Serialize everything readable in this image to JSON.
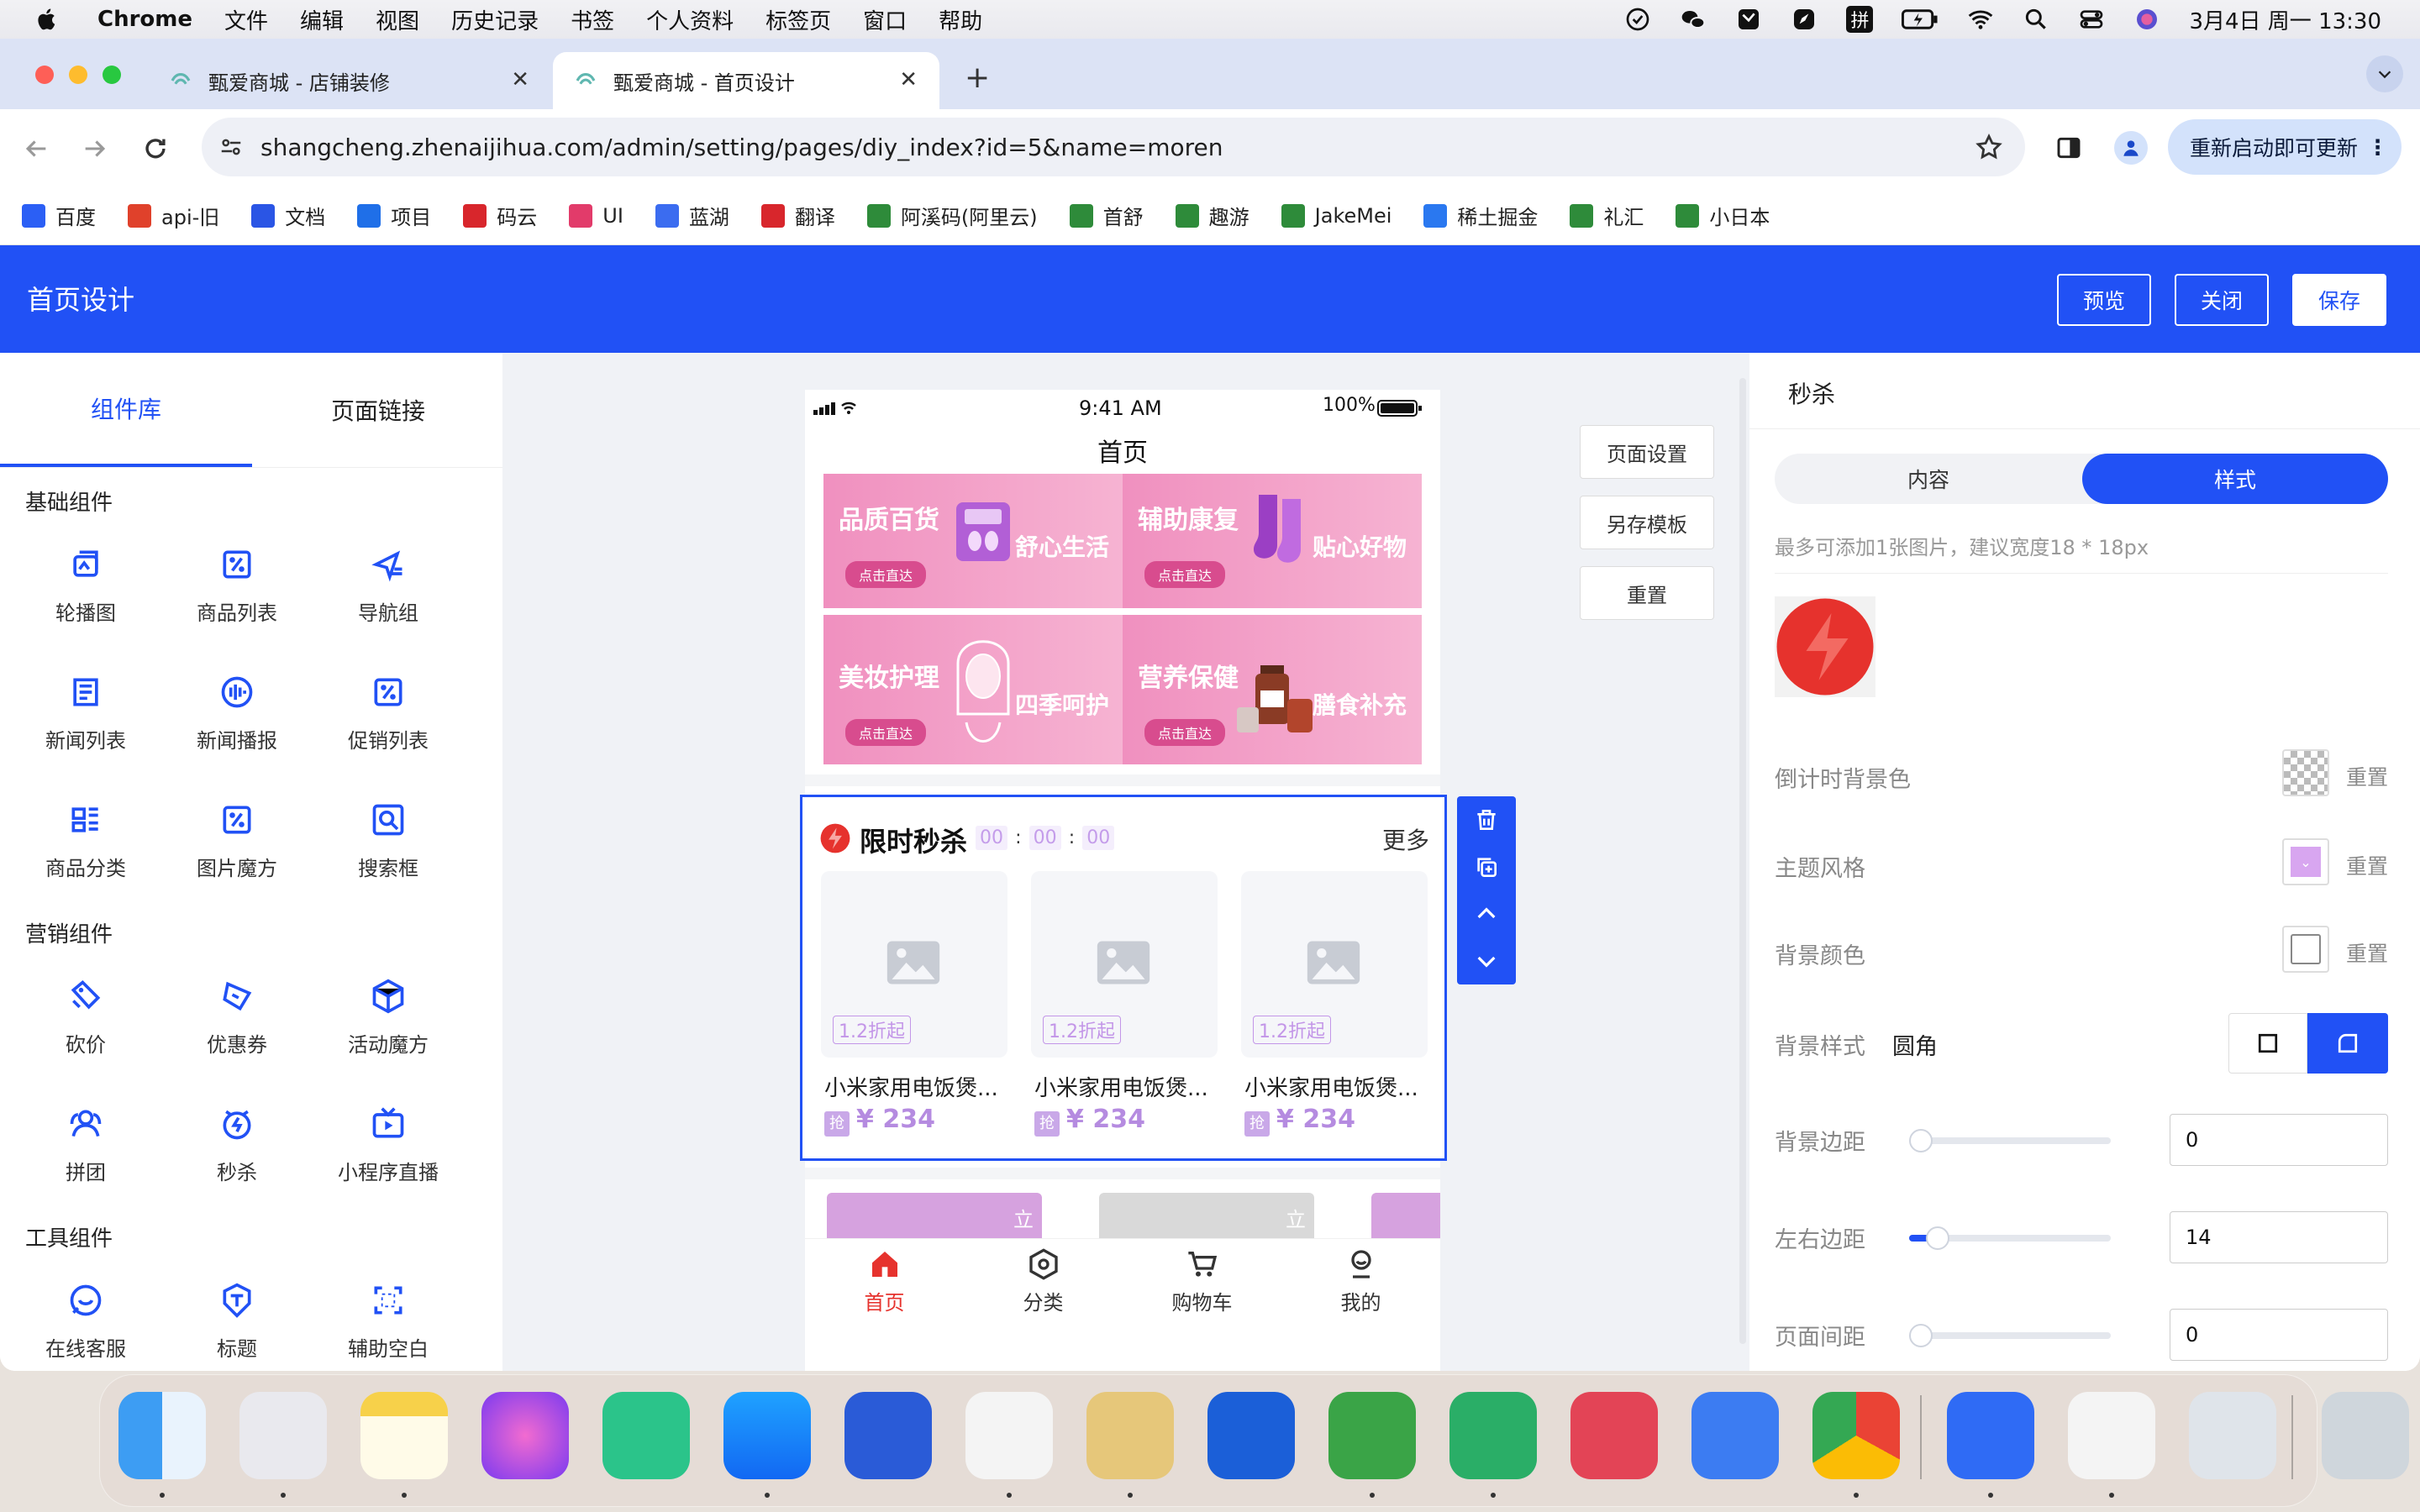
{
  "menubar": {
    "app": "Chrome",
    "menus": [
      "文件",
      "编辑",
      "视图",
      "历史记录",
      "书签",
      "个人资料",
      "标签页",
      "窗口",
      "帮助"
    ],
    "datetime": "3月4日 周一  13:30",
    "ime": "拼"
  },
  "tabs": [
    {
      "title": "甄爱商城 - 店铺装修"
    },
    {
      "title": "甄爱商城 - 首页设计"
    }
  ],
  "address": "shangcheng.zhenaijihua.com/admin/setting/pages/diy_index?id=5&name=moren",
  "update_button": "重新启动即可更新",
  "bookmarks": [
    {
      "label": "百度",
      "color": "#2b5ff5"
    },
    {
      "label": "api-旧",
      "color": "#e0412b"
    },
    {
      "label": "文档",
      "color": "#2a55e5"
    },
    {
      "label": "项目",
      "color": "#1f6fe8"
    },
    {
      "label": "码云",
      "color": "#d8262c"
    },
    {
      "label": "UI",
      "color": "#e23b6a"
    },
    {
      "label": "蓝湖",
      "color": "#3b6cf0"
    },
    {
      "label": "翻译",
      "color": "#d8262c"
    },
    {
      "label": "阿溪码(阿里云)",
      "color": "#2e8b3a"
    },
    {
      "label": "首舒",
      "color": "#2e8b3a"
    },
    {
      "label": "趣游",
      "color": "#2e8b3a"
    },
    {
      "label": "JakeMei",
      "color": "#2e8b3a"
    },
    {
      "label": "稀土掘金",
      "color": "#2a78f0"
    },
    {
      "label": "礼汇",
      "color": "#2e8b3a"
    },
    {
      "label": "小日本",
      "color": "#2e8b3a"
    }
  ],
  "header": {
    "title": "首页设计",
    "preview": "预览",
    "close": "关闭",
    "save": "保存",
    "accent": "#2151f5"
  },
  "left": {
    "tab_components": "组件库",
    "tab_links": "页面链接",
    "sections": [
      {
        "title": "基础组件",
        "items": [
          "轮播图",
          "商品列表",
          "导航组",
          "新闻列表",
          "新闻播报",
          "促销列表",
          "商品分类",
          "图片魔方",
          "搜索框"
        ]
      },
      {
        "title": "营销组件",
        "items": [
          "砍价",
          "优惠券",
          "活动魔方",
          "拼团",
          "秒杀",
          "小程序直播"
        ]
      },
      {
        "title": "工具组件",
        "items": [
          "在线客服",
          "标题",
          "辅助空白"
        ]
      }
    ]
  },
  "phone": {
    "status_time": "9:41 AM",
    "battery": "100%",
    "title": "首页",
    "banners": [
      {
        "title": "品质百货",
        "sub": "舒心生活",
        "btn": "点击直达"
      },
      {
        "title": "辅助康复",
        "sub": "贴心好物",
        "btn": "点击直达"
      },
      {
        "title": "美妆护理",
        "sub": "四季呵护",
        "btn": "点击直达"
      },
      {
        "title": "营养保健",
        "sub": "膳食补充",
        "btn": "点击直达"
      }
    ],
    "seckill": {
      "title": "限时秒杀",
      "timer": [
        "00",
        "00",
        "00"
      ],
      "more": "更多",
      "products": [
        {
          "tag": "1.2折起",
          "name": "小米家用电饭煲...",
          "badge": "抢",
          "price": "¥ 234"
        },
        {
          "tag": "1.2折起",
          "name": "小米家用电饭煲...",
          "badge": "抢",
          "price": "¥ 234"
        },
        {
          "tag": "1.2折起",
          "name": "小米家用电饭煲...",
          "badge": "抢",
          "price": "¥ 234"
        }
      ]
    },
    "coupon_btn": "立",
    "nav": [
      "首页",
      "分类",
      "购物车",
      "我的"
    ]
  },
  "side_buttons": [
    "页面设置",
    "另存模板",
    "重置"
  ],
  "right": {
    "title": "秒杀",
    "tab_content": "内容",
    "tab_style": "样式",
    "hint": "最多可添加1张图片，建议宽度18 * 18px",
    "countdown_bg": "倒计时背景色",
    "theme": "主题风格",
    "bg_color": "背景颜色",
    "bg_style": "背景样式",
    "bg_style_value": "圆角",
    "bg_margin": "背景边距",
    "bg_margin_value": "0",
    "lr_margin": "左右边距",
    "lr_margin_value": "14",
    "page_margin": "页面间距",
    "page_margin_value": "0",
    "reset": "重置",
    "theme_color": "#d8a6f0"
  }
}
